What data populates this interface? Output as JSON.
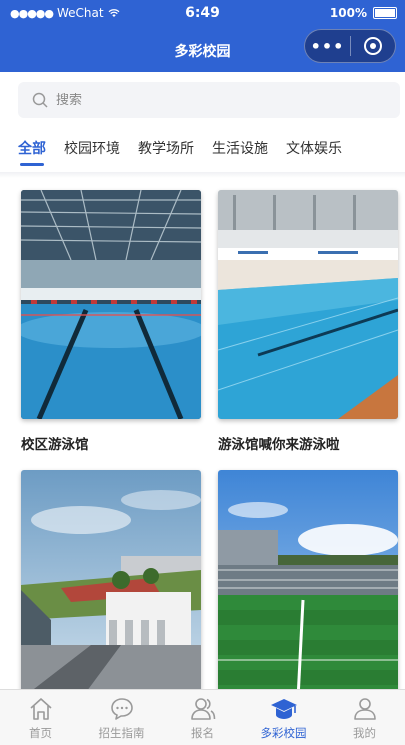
{
  "status_bar": {
    "carrier": "WeChat",
    "time": "6:49",
    "battery": "100%"
  },
  "nav": {
    "title": "多彩校园",
    "more_label": "•••"
  },
  "search": {
    "placeholder": "搜索"
  },
  "tabs": [
    {
      "label": "全部",
      "active": true
    },
    {
      "label": "校园环境",
      "active": false
    },
    {
      "label": "教学场所",
      "active": false
    },
    {
      "label": "生活设施",
      "active": false
    },
    {
      "label": "文体娱乐",
      "active": false
    }
  ],
  "cards": [
    {
      "title": "校区游泳馆",
      "image": "indoor-pool-photo"
    },
    {
      "title": "游泳馆喊你来游泳啦",
      "image": "pool-lanes-photo"
    },
    {
      "title": "",
      "image": "campus-building-rendering"
    },
    {
      "title": "",
      "image": "football-field-photo"
    }
  ],
  "tabbar": [
    {
      "label": "首页",
      "icon": "home-icon",
      "active": false
    },
    {
      "label": "招生指南",
      "icon": "chat-icon",
      "active": false
    },
    {
      "label": "报名",
      "icon": "users-icon",
      "active": false
    },
    {
      "label": "多彩校园",
      "icon": "graduation-cap-icon",
      "active": true
    },
    {
      "label": "我的",
      "icon": "user-icon",
      "active": false
    }
  ],
  "colors": {
    "primary": "#2f63d3",
    "tab_inactive": "#9a9a9a"
  }
}
